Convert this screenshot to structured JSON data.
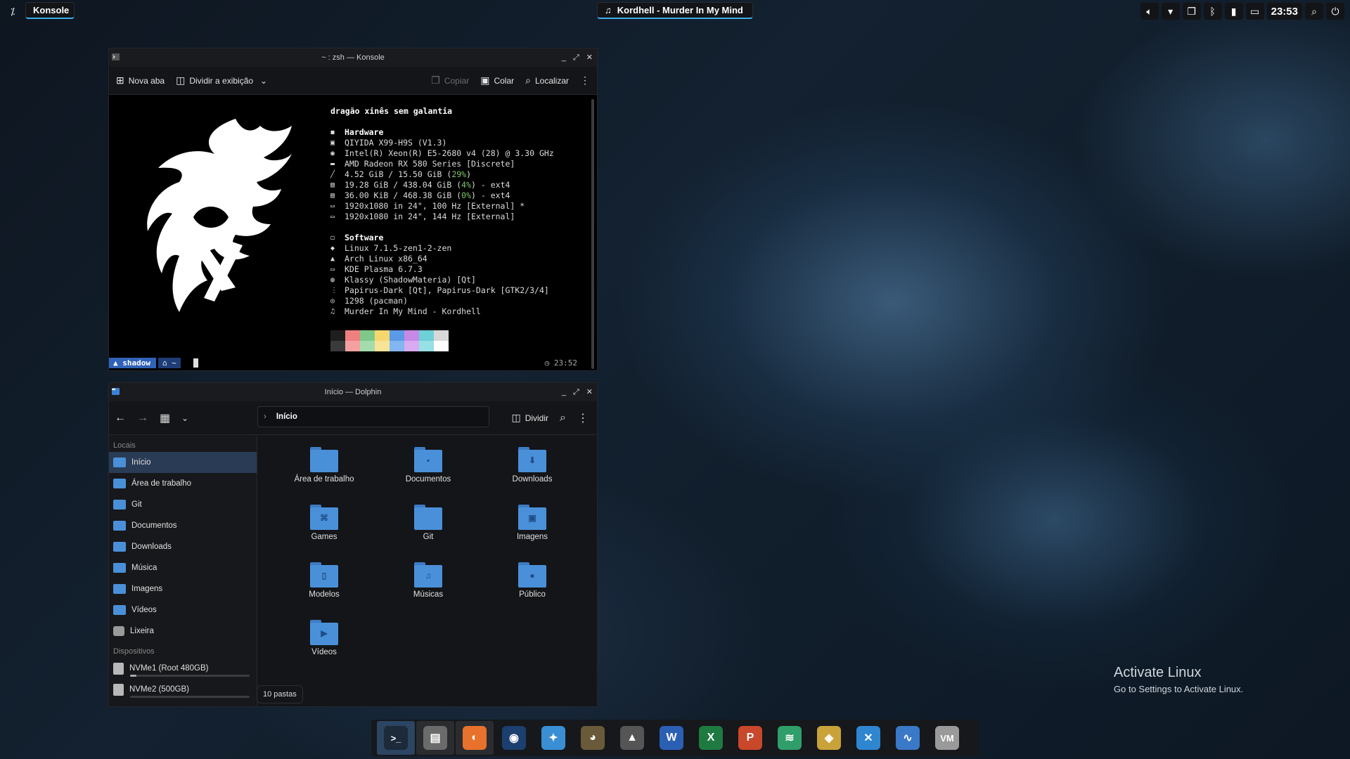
{
  "top_bar": {
    "launcher_icon": "application-launcher-icon",
    "task_konsole": "Konsole",
    "task_media": "Kordhell - Murder In My Mind",
    "clock": "23:53",
    "tray_icons": [
      "volume-icon",
      "chevron-down-icon",
      "clipboard-icon",
      "bluetooth-icon",
      "battery-icon",
      "display-icon",
      "search-icon",
      "power-icon"
    ]
  },
  "konsole": {
    "title": "~ : zsh — Konsole",
    "toolbar": {
      "new_tab": "Nova aba",
      "split_view": "Dividir a exibição",
      "copy": "Copiar",
      "paste": "Colar",
      "find": "Localizar"
    },
    "fastfetch": {
      "header": "dragão xinês sem galantia",
      "hardware_title": "Hardware",
      "hardware": [
        {
          "icon": "▣",
          "text": "QIYIDA X99-H9S (V1.3)"
        },
        {
          "icon": "◉",
          "text": "Intel(R) Xeon(R) E5-2680 v4 (28) @ 3.30 GHz"
        },
        {
          "icon": "▬",
          "text": "AMD Radeon RX 580 Series [Discrete]"
        },
        {
          "icon": "╱",
          "pre": "4.52 GiB / 15.50 GiB (",
          "hl": "29%",
          "post": ")"
        },
        {
          "icon": "▤",
          "pre": "19.28 GiB / 438.04 GiB (",
          "hl": "4%",
          "post": ") - ext4"
        },
        {
          "icon": "▤",
          "pre": "36.00 KiB / 468.38 GiB (",
          "hl": "0%",
          "post": ") - ext4"
        },
        {
          "icon": "▭",
          "text": "1920x1080 in 24\", 100 Hz [External] *"
        },
        {
          "icon": "▭",
          "text": "1920x1080 in 24\", 144 Hz [External]"
        }
      ],
      "software_title": "Software",
      "software": [
        {
          "icon": "◆",
          "text": "Linux 7.1.5-zen1-2-zen"
        },
        {
          "icon": "▲",
          "text": "Arch Linux x86_64"
        },
        {
          "icon": "▭",
          "text": "KDE Plasma 6.7.3"
        },
        {
          "icon": "◍",
          "text": "Klassy (ShadowMateria) [Qt]"
        },
        {
          "icon": "⋮",
          "text": "Papirus-Dark [Qt], Papirus-Dark [GTK2/3/4]"
        },
        {
          "icon": "◎",
          "text": "1298 (pacman)"
        },
        {
          "icon": "♫",
          "text": "Murder In My Mind - Kordhell"
        }
      ],
      "palette_top": [
        "#1e1e1e",
        "#f07f7f",
        "#7ec98a",
        "#f5d76e",
        "#5a9ae6",
        "#c68ae6",
        "#6ed0d8",
        "#d8d8d8"
      ],
      "palette_bottom": [
        "#3a3a3a",
        "#f5a0a0",
        "#a4dcae",
        "#f7e396",
        "#82b6f0",
        "#d9aaf0",
        "#96e0e6",
        "#ffffff"
      ]
    },
    "prompt": {
      "user": "shadow",
      "dir": "~",
      "time": "23:52"
    }
  },
  "dolphin": {
    "title": "Início — Dolphin",
    "breadcrumb": "Início",
    "split_label": "Dividir",
    "sidebar": {
      "places_title": "Locais",
      "places": [
        {
          "label": "Início",
          "icon": "home-folder-icon"
        },
        {
          "label": "Área de trabalho",
          "icon": "desktop-folder-icon"
        },
        {
          "label": "Git",
          "icon": "git-folder-icon"
        },
        {
          "label": "Documentos",
          "icon": "documents-folder-icon"
        },
        {
          "label": "Downloads",
          "icon": "downloads-folder-icon"
        },
        {
          "label": "Música",
          "icon": "music-folder-icon"
        },
        {
          "label": "Imagens",
          "icon": "pictures-folder-icon"
        },
        {
          "label": "Vídeos",
          "icon": "videos-folder-icon"
        },
        {
          "label": "Lixeira",
          "icon": "trash-icon"
        }
      ],
      "devices_title": "Dispositivos",
      "devices": [
        {
          "label": "NVMe1 (Root 480GB)",
          "usage": 0.05
        },
        {
          "label": "NVMe2 (500GB)",
          "usage": 0.0
        }
      ]
    },
    "files": [
      {
        "label": "Área de trabalho",
        "icon": "desktop-folder-icon",
        "glyph": ""
      },
      {
        "label": "Documentos",
        "icon": "documents-folder-icon",
        "glyph": "▪"
      },
      {
        "label": "Downloads",
        "icon": "downloads-folder-icon",
        "glyph": "⬇"
      },
      {
        "label": "Games",
        "icon": "games-folder-icon",
        "glyph": "⌘"
      },
      {
        "label": "Git",
        "icon": "git-folder-icon",
        "glyph": ""
      },
      {
        "label": "Imagens",
        "icon": "pictures-folder-icon",
        "glyph": "▣"
      },
      {
        "label": "Modelos",
        "icon": "templates-folder-icon",
        "glyph": "▯"
      },
      {
        "label": "Músicas",
        "icon": "music-folder-icon",
        "glyph": "♫"
      },
      {
        "label": "Público",
        "icon": "public-folder-icon",
        "glyph": "●"
      },
      {
        "label": "Vídeos",
        "icon": "videos-folder-icon",
        "glyph": "▶"
      }
    ],
    "status": "10 pastas"
  },
  "taskbar": [
    {
      "name": "konsole-task-icon",
      "glyph": ">_",
      "bg": "#1d2a3a",
      "state": "active"
    },
    {
      "name": "dolphin-task-icon",
      "glyph": "▤",
      "bg": "#6b6b6b",
      "state": "open"
    },
    {
      "name": "firefox-task-icon",
      "glyph": "◐",
      "bg": "#e8722c",
      "state": "open"
    },
    {
      "name": "steam-task-icon",
      "glyph": "◉",
      "bg": "#1b3f6e",
      "state": ""
    },
    {
      "name": "kde-discover-task-icon",
      "glyph": "✦",
      "bg": "#3a8fd4",
      "state": ""
    },
    {
      "name": "gimp-task-icon",
      "glyph": "◕",
      "bg": "#6a5a3a",
      "state": ""
    },
    {
      "name": "inkscape-task-icon",
      "glyph": "▲",
      "bg": "#555",
      "state": ""
    },
    {
      "name": "word-task-icon",
      "glyph": "W",
      "bg": "#2b5fb4",
      "state": ""
    },
    {
      "name": "excel-task-icon",
      "glyph": "X",
      "bg": "#1f7a42",
      "state": ""
    },
    {
      "name": "powerpoint-task-icon",
      "glyph": "P",
      "bg": "#c9472a",
      "state": ""
    },
    {
      "name": "layers-app-task-icon",
      "glyph": "≋",
      "bg": "#2f9e6a",
      "state": ""
    },
    {
      "name": "maps-task-icon",
      "glyph": "◈",
      "bg": "#c9a23a",
      "state": ""
    },
    {
      "name": "remote-desktop-task-icon",
      "glyph": "✕",
      "bg": "#2f86d0",
      "state": ""
    },
    {
      "name": "system-monitor-task-icon",
      "glyph": "∿",
      "bg": "#3a78c8",
      "state": ""
    },
    {
      "name": "vm-task-icon",
      "glyph": "VM",
      "bg": "#9a9a9a",
      "state": ""
    }
  ],
  "activate": {
    "title": "Activate Linux",
    "subtitle": "Go to Settings to Activate Linux."
  }
}
